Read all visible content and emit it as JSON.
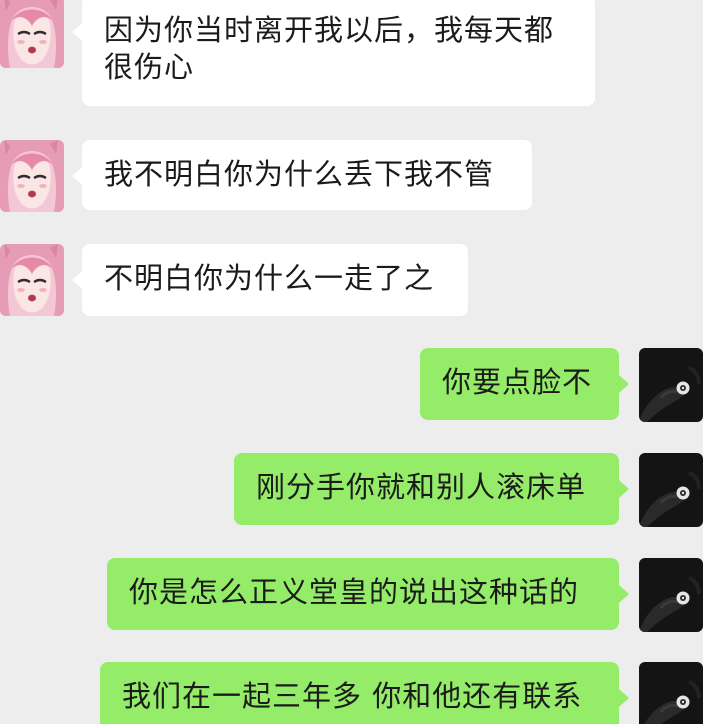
{
  "conversation": {
    "messages": [
      {
        "side": "received",
        "text": "因为你当时离开我以后，我每天都很伤心"
      },
      {
        "side": "received",
        "text": "我不明白你为什么丢下我不管"
      },
      {
        "side": "received",
        "text": "不明白你为什么一走了之"
      },
      {
        "side": "sent",
        "text": "你要点脸不"
      },
      {
        "side": "sent",
        "text": "刚分手你就和别人滚床单"
      },
      {
        "side": "sent",
        "text": "你是怎么正义堂皇的说出这种话的"
      },
      {
        "side": "sent",
        "text": "我们在一起三年多 你和他还有联系"
      }
    ]
  },
  "colors": {
    "background": "#ededed",
    "received_bubble": "#ffffff",
    "sent_bubble": "#95ec69",
    "text": "#1b1b1b"
  },
  "icons": {
    "contact_avatar": "anime-girl-avatar",
    "own_avatar": "dark-hand-avatar"
  }
}
